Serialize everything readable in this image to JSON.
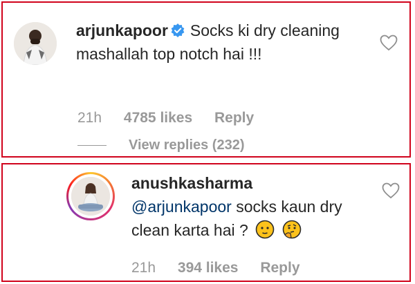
{
  "comments": [
    {
      "username": "arjunkapoor",
      "verified": true,
      "text": "Socks ki dry cleaning mashallah top notch hai !!!",
      "time": "21h",
      "likes": "4785 likes",
      "reply_label": "Reply",
      "view_replies": "View replies (232)"
    },
    {
      "username": "anushkasharma",
      "mention": "@arjunkapoor",
      "text": "socks kaun dry clean karta hai ?",
      "emojis": [
        "neutral-face-emoji",
        "thinking-face-emoji"
      ],
      "time": "21h",
      "likes": "394 likes",
      "reply_label": "Reply"
    }
  ],
  "colors": {
    "highlight_border": "#d0021b",
    "mention": "#003569",
    "meta_text": "#999999",
    "verified_badge": "#3897f0"
  }
}
